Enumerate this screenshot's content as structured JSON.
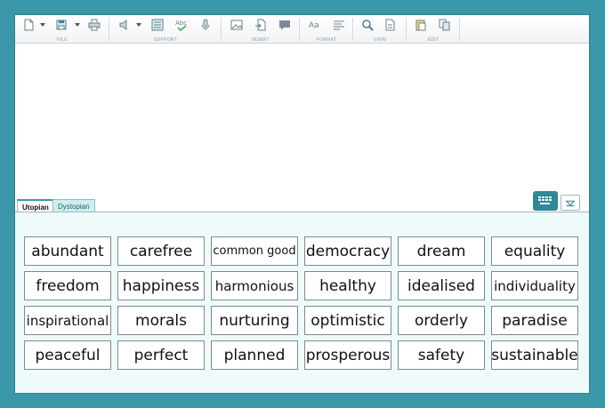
{
  "toolbar": {
    "groups": [
      {
        "label": "FILE",
        "icons": [
          "new-document-icon",
          "save-icon",
          "print-icon"
        ]
      },
      {
        "label": "SUPPORT",
        "icons": [
          "speaker-icon",
          "word-list-icon",
          "spell-check-icon",
          "microphone-icon"
        ]
      },
      {
        "label": "INSERT",
        "icons": [
          "image-icon",
          "insert-file-icon",
          "comment-icon"
        ]
      },
      {
        "label": "FORMAT",
        "icons": [
          "font-icon",
          "align-icon"
        ]
      },
      {
        "label": "VIEW",
        "icons": [
          "zoom-icon",
          "page-view-icon"
        ]
      },
      {
        "label": "EDIT",
        "icons": [
          "paste-icon",
          "copy-icon"
        ]
      }
    ]
  },
  "tabs": [
    {
      "label": "Utopian",
      "active": true
    },
    {
      "label": "Dystopian",
      "active": false
    }
  ],
  "words": [
    "abundant",
    "carefree",
    "common good",
    "democracy",
    "dream",
    "equality",
    "freedom",
    "happiness",
    "harmonious",
    "healthy",
    "idealised",
    "individuality",
    "inspirational",
    "morals",
    "nurturing",
    "optimistic",
    "orderly",
    "paradise",
    "peaceful",
    "perfect",
    "planned",
    "prosperous",
    "safety",
    "sustainable"
  ],
  "colors": {
    "background": "#3a97a7",
    "accent": "#2f8797",
    "wordbank_bg": "#effbfa",
    "inactive_tab": "#cdeff0"
  }
}
